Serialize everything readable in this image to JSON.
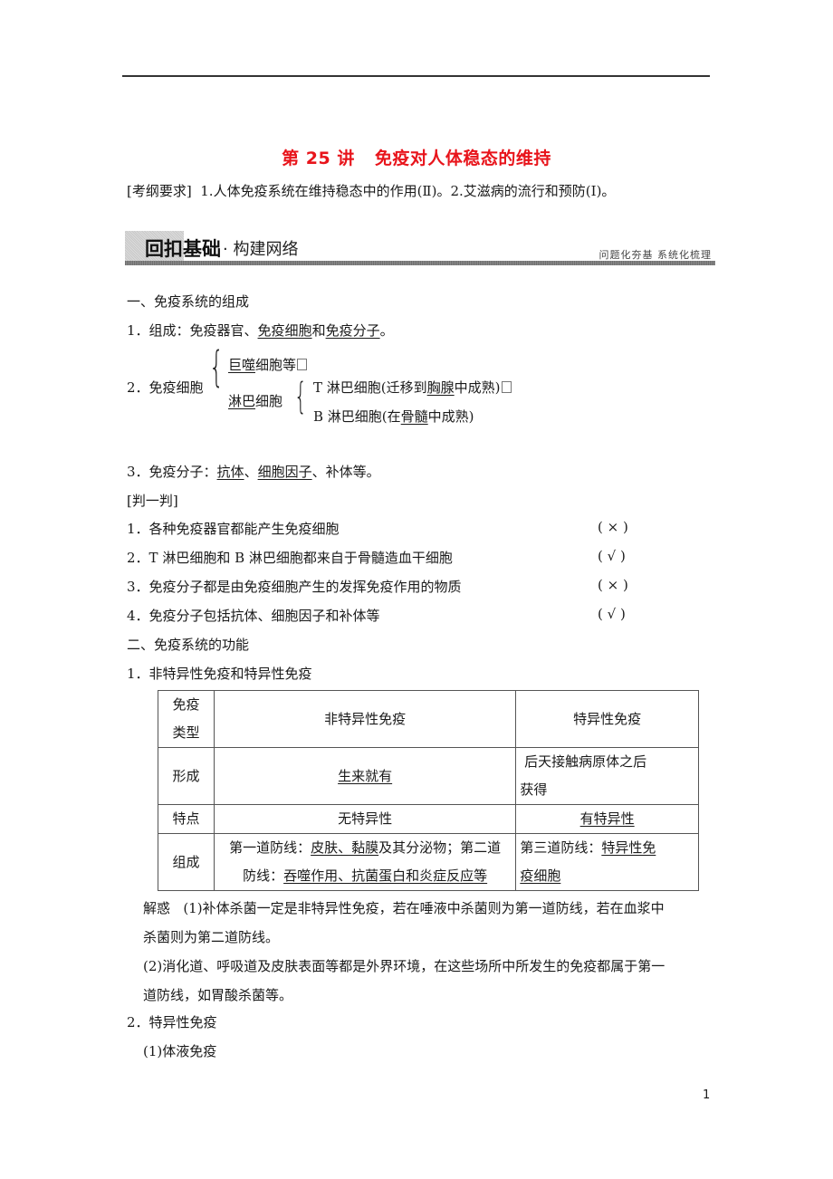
{
  "header": {
    "title_lecture": "第 25 讲",
    "title_topic": "免疫对人体稳态的维持",
    "requirement_label": "[考纲要求]",
    "requirement_text": "1.人体免疫系统在维持稳态中的作用(Ⅱ)。2.艾滋病的流行和预防(Ⅰ)。"
  },
  "banner": {
    "main": "回扣基础",
    "dot": "·",
    "sub": "构建网络",
    "right": "问题化夯基  系统化梳理"
  },
  "section1": {
    "heading": "一、免疫系统的组成",
    "item1": {
      "prefix": "1．组成：免疫器官、",
      "u1": "免疫细胞",
      "mid": "和",
      "u2": "免疫分子",
      "end": "。"
    },
    "item2": {
      "label": "2．免疫细胞",
      "branch1_u": "巨噬",
      "branch1_rest": "细胞等",
      "branch2_u": "淋巴",
      "branch2_rest": "细胞",
      "t_prefix": "T 淋巴细胞(迁移到",
      "t_u": "胸腺",
      "t_suffix": "中成熟)",
      "b_prefix": "B 淋巴细胞(在",
      "b_u": "骨髓",
      "b_suffix": "中成熟)"
    },
    "item3": {
      "prefix": "3．免疫分子：",
      "u1": "抗体",
      "sep": "、",
      "u2": "细胞因子",
      "end": "、补体等。"
    }
  },
  "judge": {
    "heading": "[判一判]",
    "items": [
      {
        "text": "1．各种免疫器官都能产生免疫细胞",
        "answer": "(  ×  )"
      },
      {
        "text": "2．T 淋巴细胞和 B 淋巴细胞都来自于骨髓造血干细胞",
        "answer": "(  √  )"
      },
      {
        "text": "3．免疫分子都是由免疫细胞产生的发挥免疫作用的物质",
        "answer": "(  ×  )"
      },
      {
        "text": "4．免疫分子包括抗体、细胞因子和补体等",
        "answer": "(  √  )"
      }
    ]
  },
  "section2": {
    "heading": "二、免疫系统的功能",
    "item1": "1．非特异性免疫和特异性免疫",
    "table": {
      "header": {
        "c0_l1": "免疫",
        "c0_l2": "类型",
        "c1": "非特异性免疫",
        "c2": "特异性免疫"
      },
      "row_form": {
        "c0": "形成",
        "c1_u": "生来就有",
        "c2_l1": "后天接触病原体之后",
        "c2_l2": "获得"
      },
      "row_feat": {
        "c0": "特点",
        "c1": "无特异性",
        "c2_u": "有特异性"
      },
      "row_comp": {
        "c0": "组成",
        "c1_a": "第一道防线：",
        "c1_u1": "皮肤、黏膜",
        "c1_b": "及其分泌物；第二道",
        "c1_c": "防线：",
        "c1_u2": "吞噬作用、抗菌蛋白和炎症反应等",
        "c2_a": "第三道防线：",
        "c2_u1": "特异性免",
        "c2_u2": "疫细胞"
      }
    },
    "clarify": {
      "label": "解惑",
      "p1_l1": "(1)补体杀菌一定是非特异性免疫，若在唾液中杀菌则为第一道防线，若在血浆中",
      "p1_l2": "杀菌则为第二道防线。",
      "p2_l1": "(2)消化道、呼吸道及皮肤表面等都是外界环境，在这些场所中所发生的免疫都属于第一",
      "p2_l2": "道防线，如胃酸杀菌等。"
    },
    "item2": "2．特异性免疫",
    "item2_sub1": "(1)体液免疫"
  },
  "footer": {
    "page_number": "1"
  }
}
